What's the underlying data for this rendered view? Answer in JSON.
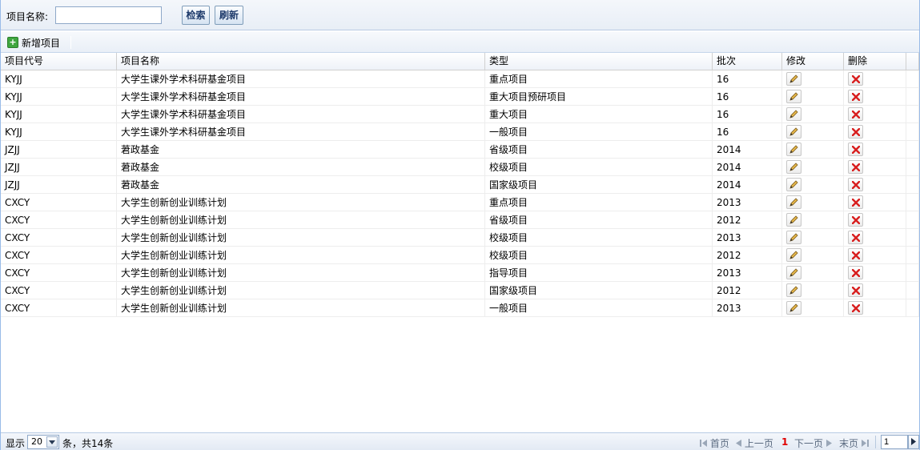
{
  "search": {
    "label": "项目名称:",
    "value": "",
    "placeholder": "",
    "search_button": "检索",
    "refresh_button": "刷新"
  },
  "toolbar": {
    "add_label": "新增项目",
    "add_icon": "add-document-icon"
  },
  "grid": {
    "columns": [
      "项目代号",
      "项目名称",
      "类型",
      "批次",
      "修改",
      "删除"
    ],
    "rows": [
      {
        "code": "KYJJ",
        "name": "大学生课外学术科研基金项目",
        "type": "重点项目",
        "batch": "16"
      },
      {
        "code": "KYJJ",
        "name": "大学生课外学术科研基金项目",
        "type": "重大项目预研项目",
        "batch": "16"
      },
      {
        "code": "KYJJ",
        "name": "大学生课外学术科研基金项目",
        "type": "重大项目",
        "batch": "16"
      },
      {
        "code": "KYJJ",
        "name": "大学生课外学术科研基金项目",
        "type": "一般项目",
        "batch": "16"
      },
      {
        "code": "JZJJ",
        "name": "莙政基金",
        "type": "省级项目",
        "batch": "2014"
      },
      {
        "code": "JZJJ",
        "name": "莙政基金",
        "type": "校级项目",
        "batch": "2014"
      },
      {
        "code": "JZJJ",
        "name": "莙政基金",
        "type": "国家级项目",
        "batch": "2014"
      },
      {
        "code": "CXCY",
        "name": "大学生创新创业训练计划",
        "type": "重点项目",
        "batch": "2013"
      },
      {
        "code": "CXCY",
        "name": "大学生创新创业训练计划",
        "type": "省级项目",
        "batch": "2012"
      },
      {
        "code": "CXCY",
        "name": "大学生创新创业训练计划",
        "type": "校级项目",
        "batch": "2013"
      },
      {
        "code": "CXCY",
        "name": "大学生创新创业训练计划",
        "type": "校级项目",
        "batch": "2012"
      },
      {
        "code": "CXCY",
        "name": "大学生创新创业训练计划",
        "type": "指导项目",
        "batch": "2013"
      },
      {
        "code": "CXCY",
        "name": "大学生创新创业训练计划",
        "type": "国家级项目",
        "batch": "2012"
      },
      {
        "code": "CXCY",
        "name": "大学生创新创业训练计划",
        "type": "一般项目",
        "batch": "2013"
      }
    ],
    "edit_icon": "pencil-icon",
    "delete_icon": "delete-x-icon"
  },
  "footer": {
    "show_label": "显示",
    "page_size": "20",
    "count_text": "条，共14条",
    "first": "首页",
    "prev": "上一页",
    "current_page": "1",
    "next": "下一页",
    "last": "末页",
    "page_input": "1"
  },
  "colors": {
    "accent_border": "#99bbe8",
    "delete_red": "#d81e1e",
    "current_page_red": "#e00000",
    "add_green": "#3fa63f"
  }
}
